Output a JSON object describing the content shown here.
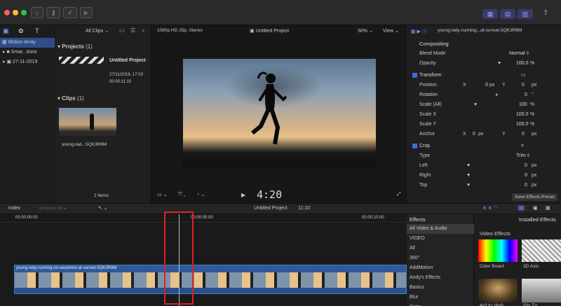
{
  "sidebar": {
    "items": [
      {
        "label": "Motion Array"
      },
      {
        "label": "Smar...tions"
      },
      {
        "label": "27-11-2019"
      }
    ]
  },
  "browser": {
    "filter": "All Clips",
    "projects_label": "Projects",
    "projects_count": "(1)",
    "project_name": "Untitled Project",
    "project_date": "27/11/2019, 17:03",
    "project_duration": "00:00:11:10",
    "clips_label": "Clips",
    "clips_count": "(1)",
    "clip_name": "young-lad...5QK3R8M",
    "items_count": "2 items"
  },
  "viewer": {
    "format": "1080p HD 25p, Stereo",
    "project": "Untitled Project",
    "zoom": "50%",
    "view": "View",
    "timecode": "4:20"
  },
  "inspector": {
    "clip_title": "young-lady-running...at-sunset-5QK3R8M",
    "compositing": "Compositing",
    "blend_mode_label": "Blend Mode",
    "blend_mode": "Normal ◊",
    "opacity_label": "Opacity",
    "opacity": "100.0",
    "transform": "Transform",
    "position": "Position",
    "pos_x": "0",
    "pos_y": "0",
    "rotation": "Rotation",
    "rotation_val": "0",
    "scale_all": "Scale (All)",
    "scale_all_val": "100",
    "scale_x": "Scale X",
    "scale_x_val": "100.0",
    "scale_y": "Scale Y",
    "scale_y_val": "100.0",
    "anchor": "Anchor",
    "anchor_x": "0",
    "anchor_y": "0",
    "crop": "Crop",
    "type": "Type",
    "type_val": "Trim ◊",
    "left": "Left",
    "left_val": "0",
    "right": "Right",
    "right_val": "0",
    "top": "Top",
    "top_val": "0",
    "save_preset": "Save Effects Preset",
    "unit_px": "px",
    "unit_pct": "%",
    "unit_deg": "°",
    "x": "X",
    "y": "Y"
  },
  "timeline": {
    "index": "Index",
    "project": "Untitled Project",
    "duration": "11:10",
    "tc_start": "00:00:00:00",
    "tc_mid": "00:00:05:00",
    "tc_end": "00:00:10:00",
    "clip_name": "young-lady-running-on-seashore-at-sunset-5QK3R8M"
  },
  "effects": {
    "header": "Effects",
    "installed": "Installed Effects",
    "categories": [
      "All Video & Audio",
      "VIDEO",
      "All",
      "360°",
      "AddMotion",
      "Andy's Effects",
      "Basics",
      "Blur",
      "Color"
    ],
    "video_effects": "Video Effects",
    "thumbs": [
      "Color Board",
      "3D Axis",
      "4x3 to 16x9",
      "50s TV"
    ]
  },
  "colors": {
    "accent": "#3b6fd8",
    "playhead_box": "#e02020"
  }
}
